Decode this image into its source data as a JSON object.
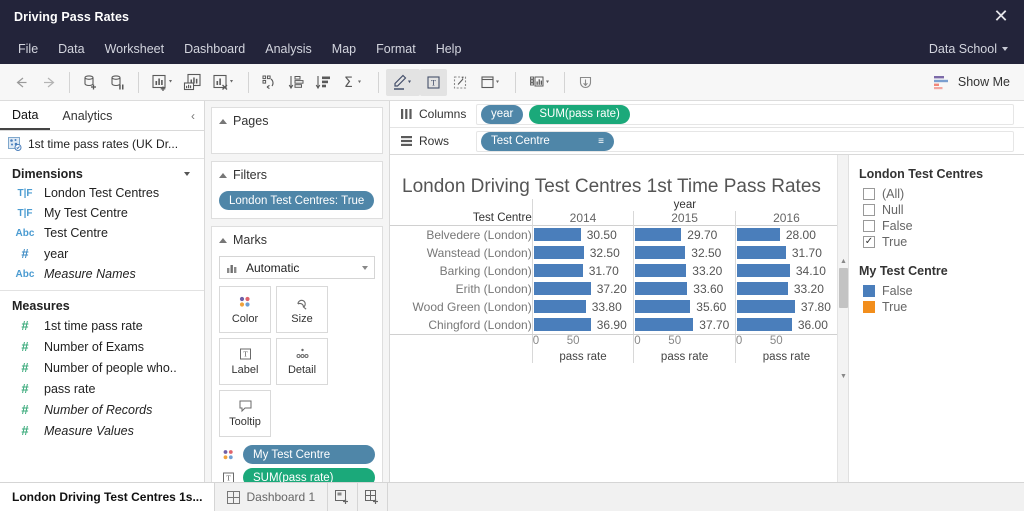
{
  "window": {
    "title": "Driving Pass Rates",
    "close_label": "✕"
  },
  "menu": {
    "items": [
      "File",
      "Data",
      "Worksheet",
      "Dashboard",
      "Analysis",
      "Map",
      "Format",
      "Help"
    ],
    "account": "Data School"
  },
  "toolbar": {
    "show_me": "Show Me",
    "icons": [
      "back-arrow-icon",
      "forward-arrow-icon",
      "new-data-source-icon",
      "pause-data-source-icon",
      "new-worksheet-icon",
      "duplicate-sheet-icon",
      "clear-sheet-icon",
      "swap-rows-columns-icon",
      "sort-ascending-icon",
      "sort-descending-icon",
      "totals-icon",
      "highlighter-icon",
      "show-labels-icon",
      "fix-axes-icon",
      "presentation-mode-icon",
      "fit-icon",
      "download-icon"
    ]
  },
  "data_pane": {
    "tabs": [
      "Data",
      "Analytics"
    ],
    "selected_tab": "Data",
    "collapse_label": "‹",
    "source": "1st time pass rates (UK Dr...",
    "sections": [
      {
        "title": "Dimensions",
        "fields": [
          {
            "icon": "T|F",
            "label": "London Test Centres",
            "italic": false
          },
          {
            "icon": "T|F",
            "label": "My Test Centre",
            "italic": false
          },
          {
            "icon": "Abc",
            "label": "Test Centre",
            "italic": false
          },
          {
            "icon": "#",
            "label": "year",
            "italic": false
          },
          {
            "icon": "Abc",
            "label": "Measure Names",
            "italic": true
          }
        ]
      },
      {
        "title": "Measures",
        "fields": [
          {
            "icon": "#",
            "label": "1st time pass rate",
            "italic": false
          },
          {
            "icon": "#",
            "label": "Number of Exams",
            "italic": false
          },
          {
            "icon": "#",
            "label": "Number of people who..",
            "italic": false
          },
          {
            "icon": "#",
            "label": "pass rate",
            "italic": false
          },
          {
            "icon": "#",
            "label": "Number of Records",
            "italic": true
          },
          {
            "icon": "#",
            "label": "Measure Values",
            "italic": true
          }
        ]
      }
    ]
  },
  "shelves": {
    "pages": {
      "title": "Pages",
      "items": []
    },
    "filters": {
      "title": "Filters",
      "items": [
        "London Test Centres: True"
      ]
    },
    "marks": {
      "title": "Marks",
      "mark_type": "Automatic",
      "buttons": [
        "Color",
        "Size",
        "Label",
        "Detail",
        "Tooltip"
      ],
      "pills": [
        {
          "label": "My Test Centre",
          "color": "blue",
          "icon": "color-icon"
        },
        {
          "label": "SUM(pass rate)",
          "color": "green",
          "icon": "label-icon"
        }
      ]
    }
  },
  "shelf_bar": {
    "columns_label": "Columns",
    "columns_pills": [
      {
        "label": "year",
        "color": "blue"
      },
      {
        "label": "SUM(pass rate)",
        "color": "green"
      }
    ],
    "rows_label": "Rows",
    "rows_pills": [
      {
        "label": "Test Centre",
        "color": "blue",
        "sort": "≡"
      }
    ]
  },
  "chart_data": {
    "type": "bar",
    "title": "London Driving Test Centres 1st Time Pass Rates",
    "row_header": "Test Centre",
    "column_group_label": "year",
    "categories": [
      "2014",
      "2015",
      "2016"
    ],
    "rows": [
      {
        "name": "Belvedere (London)",
        "values": [
          "30.50",
          "29.70",
          "28.00"
        ]
      },
      {
        "name": "Wanstead (London)",
        "values": [
          "32.50",
          "32.50",
          "31.70"
        ]
      },
      {
        "name": "Barking (London)",
        "values": [
          "31.70",
          "33.20",
          "34.10"
        ]
      },
      {
        "name": "Erith (London)",
        "values": [
          "37.20",
          "33.60",
          "33.20"
        ]
      },
      {
        "name": "Wood Green (London)",
        "values": [
          "33.80",
          "35.60",
          "37.80"
        ]
      },
      {
        "name": "Chingford (London)",
        "values": [
          "36.90",
          "37.70",
          "36.00"
        ]
      }
    ],
    "xlabel": "pass rate",
    "axis_ticks": [
      "0",
      "50"
    ],
    "xlim": [
      0,
      62
    ],
    "bar_color": "#4a7ebb",
    "grid": false
  },
  "legends": {
    "filter": {
      "title": "London Test Centres",
      "options": [
        {
          "label": "(All)",
          "checked": false
        },
        {
          "label": "Null",
          "checked": false
        },
        {
          "label": "False",
          "checked": false
        },
        {
          "label": "True",
          "checked": true
        }
      ],
      "check_glyph": "✓"
    },
    "color": {
      "title": "My Test Centre",
      "items": [
        {
          "label": "False",
          "color": "#4a7ebb"
        },
        {
          "label": "True",
          "color": "#f28e1c"
        }
      ]
    }
  },
  "bottom_tabs": {
    "sheets": [
      {
        "label": "London Driving Test Centres 1s...",
        "selected": true
      },
      {
        "label": "Dashboard 1",
        "selected": false
      }
    ],
    "new_buttons": [
      "new-worksheet-tab-icon",
      "new-dashboard-tab-icon"
    ]
  }
}
